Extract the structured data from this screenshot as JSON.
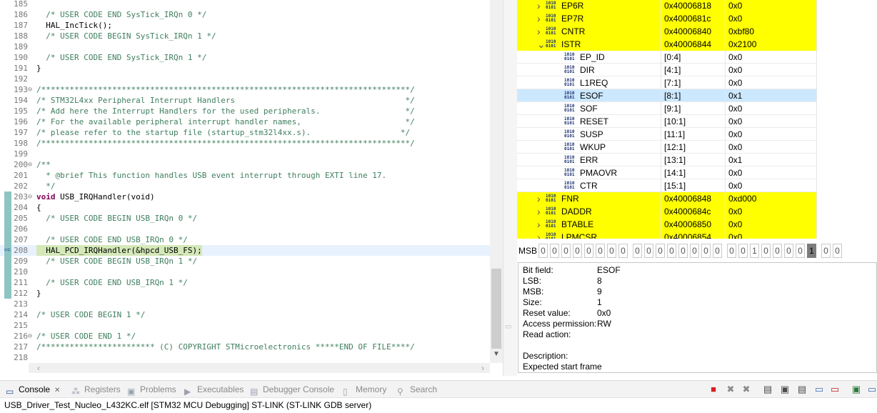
{
  "editor": {
    "lines": [
      {
        "n": "185",
        "t": "",
        "c": ""
      },
      {
        "n": "186",
        "t": "  /* USER CODE END SysTick_IRQn 0 */",
        "c": "comment"
      },
      {
        "n": "187",
        "t": "  HAL_IncTick();",
        "c": "kw"
      },
      {
        "n": "188",
        "t": "  /* USER CODE BEGIN SysTick_IRQn 1 */",
        "c": "comment"
      },
      {
        "n": "189",
        "t": "",
        "c": ""
      },
      {
        "n": "190",
        "t": "  /* USER CODE END SysTick_IRQn 1 */",
        "c": "comment"
      },
      {
        "n": "191",
        "t": "}",
        "c": "kw"
      },
      {
        "n": "192",
        "t": "",
        "c": ""
      },
      {
        "n": "193",
        "t": "/******************************************************************************/",
        "c": "comment",
        "fold": true
      },
      {
        "n": "194",
        "t": "/* STM32L4xx Peripheral Interrupt Handlers                                    */",
        "c": "comment"
      },
      {
        "n": "195",
        "t": "/* Add here the Interrupt Handlers for the used peripherals.                  */",
        "c": "comment"
      },
      {
        "n": "196",
        "t": "/* For the available peripheral interrupt handler names,                      */",
        "c": "comment"
      },
      {
        "n": "197",
        "t": "/* please refer to the startup file (startup_stm32l4xx.s).                   */",
        "c": "comment"
      },
      {
        "n": "198",
        "t": "/******************************************************************************/",
        "c": "comment"
      },
      {
        "n": "199",
        "t": "",
        "c": ""
      },
      {
        "n": "200",
        "t": "/**",
        "c": "comment",
        "fold": true
      },
      {
        "n": "201",
        "t": "  * @brief This function handles USB event interrupt through EXTI line 17.",
        "c": "comment"
      },
      {
        "n": "202",
        "t": "  */",
        "c": "comment"
      },
      {
        "n": "203",
        "t": "USB_IRQHandler(void)",
        "c": "kw",
        "fold": true,
        "prefix": "void "
      },
      {
        "n": "204",
        "t": "{",
        "c": "kw"
      },
      {
        "n": "205",
        "t": "  /* USER CODE BEGIN USB_IRQn 0 */",
        "c": "comment"
      },
      {
        "n": "206",
        "t": "",
        "c": ""
      },
      {
        "n": "207",
        "t": "  /* USER CODE END USB_IRQn 0 */",
        "c": "comment"
      },
      {
        "n": "208",
        "t": "  HAL_PCD_IRQHandler(&hpcd_USB_FS);",
        "c": "kw",
        "current": true
      },
      {
        "n": "209",
        "t": "  /* USER CODE BEGIN USB_IRQn 1 */",
        "c": "comment"
      },
      {
        "n": "210",
        "t": "",
        "c": ""
      },
      {
        "n": "211",
        "t": "  /* USER CODE END USB_IRQn 1 */",
        "c": "comment"
      },
      {
        "n": "212",
        "t": "}",
        "c": "kw"
      },
      {
        "n": "213",
        "t": "",
        "c": ""
      },
      {
        "n": "214",
        "t": "/* USER CODE BEGIN 1 */",
        "c": "comment"
      },
      {
        "n": "215",
        "t": "",
        "c": ""
      },
      {
        "n": "216",
        "t": "/* USER CODE END 1 */",
        "c": "comment",
        "fold": true
      },
      {
        "n": "217",
        "t": "/************************ (C) COPYRIGHT STMicroelectronics *****END OF FILE****/",
        "c": "comment"
      },
      {
        "n": "218",
        "t": "",
        "c": ""
      }
    ]
  },
  "registers": {
    "rows": [
      {
        "name": "EP6R",
        "addr": "0x40006818",
        "val": "0x0",
        "kind": "reg",
        "hl": true,
        "chev": "›"
      },
      {
        "name": "EP7R",
        "addr": "0x4000681c",
        "val": "0x0",
        "kind": "reg",
        "hl": true,
        "chev": "›"
      },
      {
        "name": "CNTR",
        "addr": "0x40006840",
        "val": "0xbf80",
        "kind": "reg",
        "hl": true,
        "chev": "›"
      },
      {
        "name": "ISTR",
        "addr": "0x40006844",
        "val": "0x2100",
        "kind": "reg",
        "hl": true,
        "chev": "⌄"
      },
      {
        "name": "EP_ID",
        "addr": "[0:4]",
        "val": "0x0",
        "kind": "field"
      },
      {
        "name": "DIR",
        "addr": "[4:1]",
        "val": "0x0",
        "kind": "field"
      },
      {
        "name": "L1REQ",
        "addr": "[7:1]",
        "val": "0x0",
        "kind": "field"
      },
      {
        "name": "ESOF",
        "addr": "[8:1]",
        "val": "0x1",
        "kind": "field",
        "sel": true
      },
      {
        "name": "SOF",
        "addr": "[9:1]",
        "val": "0x0",
        "kind": "field"
      },
      {
        "name": "RESET",
        "addr": "[10:1]",
        "val": "0x0",
        "kind": "field"
      },
      {
        "name": "SUSP",
        "addr": "[11:1]",
        "val": "0x0",
        "kind": "field"
      },
      {
        "name": "WKUP",
        "addr": "[12:1]",
        "val": "0x0",
        "kind": "field"
      },
      {
        "name": "ERR",
        "addr": "[13:1]",
        "val": "0x1",
        "kind": "field"
      },
      {
        "name": "PMAOVR",
        "addr": "[14:1]",
        "val": "0x0",
        "kind": "field"
      },
      {
        "name": "CTR",
        "addr": "[15:1]",
        "val": "0x0",
        "kind": "field"
      },
      {
        "name": "FNR",
        "addr": "0x40006848",
        "val": "0xd000",
        "kind": "reg",
        "hl": true,
        "chev": "›"
      },
      {
        "name": "DADDR",
        "addr": "0x4000684c",
        "val": "0x0",
        "kind": "reg",
        "hl": true,
        "chev": "›"
      },
      {
        "name": "BTABLE",
        "addr": "0x40006850",
        "val": "0x0",
        "kind": "reg",
        "hl": true,
        "chev": "›"
      },
      {
        "name": "LPMCSR",
        "addr": "0x40006854",
        "val": "0x0",
        "kind": "reg",
        "hl": true,
        "chev": "›"
      }
    ],
    "icon_text": "1010\n0101"
  },
  "msb": {
    "label": "MSB",
    "bits": [
      "0",
      "0",
      "0",
      "0",
      "0",
      "0",
      "0",
      "0",
      "0",
      "0",
      "0",
      "0",
      "0",
      "0",
      "0",
      "0",
      "0",
      "0",
      "1",
      "0",
      "0",
      "0",
      "0",
      "1",
      "0",
      "0"
    ],
    "selected_index": 23
  },
  "details": {
    "rows": [
      {
        "k": "Bit field:",
        "v": "ESOF"
      },
      {
        "k": "LSB:",
        "v": "8"
      },
      {
        "k": "MSB:",
        "v": "9"
      },
      {
        "k": "Size:",
        "v": "1"
      },
      {
        "k": "Reset value:",
        "v": "0x0"
      },
      {
        "k": "Access permission:",
        "v": "RW"
      },
      {
        "k": "Read action:",
        "v": ""
      },
      {
        "k": "",
        "v": ""
      },
      {
        "k": "Description:",
        "v": ""
      },
      {
        "k": "Expected start frame",
        "v": ""
      }
    ]
  },
  "bottom": {
    "tabs": [
      {
        "label": "Console",
        "icon": "console-icon",
        "active": true
      },
      {
        "label": "Registers",
        "icon": "registers-icon"
      },
      {
        "label": "Problems",
        "icon": "problems-icon"
      },
      {
        "label": "Executables",
        "icon": "executables-icon"
      },
      {
        "label": "Debugger Console",
        "icon": "debugger-console-icon"
      },
      {
        "label": "Memory",
        "icon": "memory-icon"
      },
      {
        "label": "Search",
        "icon": "search-icon"
      }
    ],
    "close_glyph": "✕",
    "console_text": "USB_Driver_Test_Nucleo_L432KC.elf [STM32 MCU Debugging] ST-LINK (ST-LINK GDB server)",
    "toolbar_icons": [
      "terminate-icon",
      "remove-launch-icon",
      "remove-all-icon",
      "pin-icon",
      "scroll-lock-icon",
      "word-wrap-icon",
      "show-on-output-icon",
      "show-on-error-icon",
      "open-console-icon",
      "display-console-icon"
    ]
  },
  "colors": {
    "highlight": "#ffff00",
    "selection": "#cce8ff",
    "comment": "#3f7f5f",
    "keyword": "#7f0055"
  }
}
